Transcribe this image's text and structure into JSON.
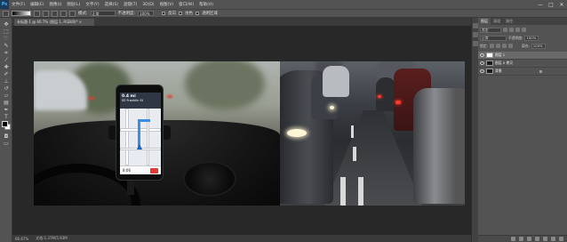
{
  "app": {
    "logo": "Ps"
  },
  "menu": [
    "文件(F)",
    "编辑(E)",
    "图像(I)",
    "图层(L)",
    "文字(Y)",
    "选择(S)",
    "滤镜(T)",
    "3D(D)",
    "视图(V)",
    "窗口(W)",
    "帮助(H)"
  ],
  "window_controls": {
    "min": "—",
    "max": "□",
    "close": "✕"
  },
  "options": {
    "mode_label": "模式:",
    "mode_value": "正常",
    "opacity_label": "不透明度:",
    "opacity_value": "100%",
    "reverse_label": "反向",
    "dither_label": "仿色",
    "transparency_label": "透明区域"
  },
  "document": {
    "tab_title": "未标题-1 @ 66.7% (图层 1, RGB/8)*  ×"
  },
  "status": {
    "zoom": "66.67%",
    "doc_info": "文档:1.37M/5.93M"
  },
  "panel": {
    "tabs": [
      "图层",
      "通道",
      "路径"
    ],
    "kind_label": "类型",
    "blend_mode": "正常",
    "opacity_label": "不透明度:",
    "opacity_value": "100%",
    "lock_label": "锁定:",
    "fill_label": "填充:",
    "fill_value": "100%",
    "layers": [
      {
        "name": "图层 1"
      },
      {
        "name": "图层 0 拷贝"
      },
      {
        "name": "背景"
      }
    ]
  },
  "phone_screen": {
    "distance": "0.4 mi",
    "street": "SE Franklin St",
    "time": "8:06"
  }
}
